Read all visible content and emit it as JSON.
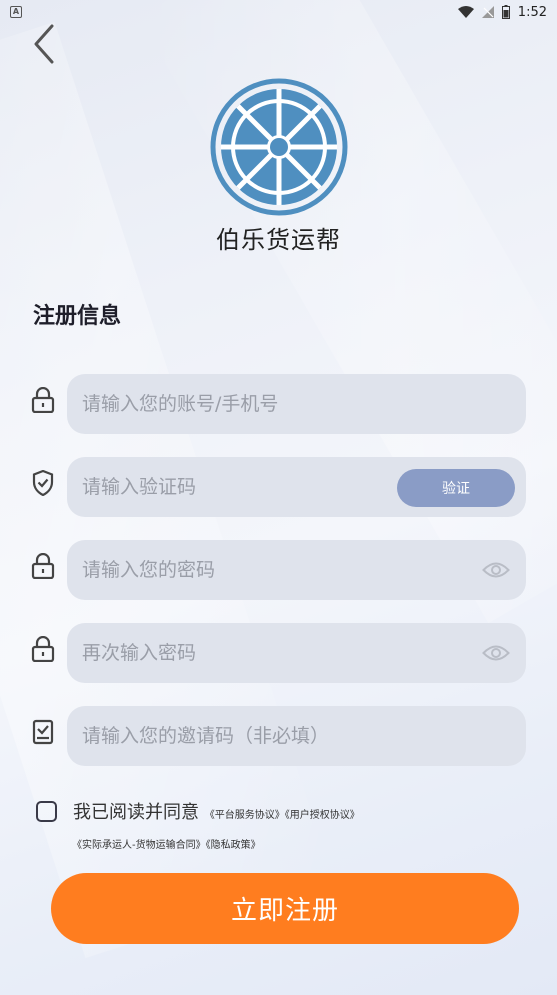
{
  "status_bar": {
    "app_indicator": "A",
    "time": "1:52",
    "icons": [
      "wifi-icon",
      "signal-off-icon",
      "battery-icon"
    ]
  },
  "header": {
    "back_icon": "chevron-left-icon",
    "app_name": "伯乐货运帮",
    "logo_icon": "wheel-logo"
  },
  "form": {
    "section_title": "注册信息",
    "account": {
      "placeholder": "请输入您的账号/手机号",
      "value": "",
      "icon": "lock-icon"
    },
    "code": {
      "placeholder": "请输入验证码",
      "value": "",
      "icon": "shield-check-icon",
      "button_label": "验证"
    },
    "password": {
      "placeholder": "请输入您的密码",
      "value": "",
      "icon": "lock-icon",
      "toggle_icon": "eye-icon"
    },
    "confirm_password": {
      "placeholder": "再次输入密码",
      "value": "",
      "icon": "lock-icon",
      "toggle_icon": "eye-icon"
    },
    "invite_code": {
      "placeholder": "请输入您的邀请码（非必填）",
      "value": "",
      "icon": "badge-check-icon"
    }
  },
  "agreement": {
    "checked": false,
    "prefix": "我已阅读并同意",
    "links": [
      "《平台服务协议》",
      "《用户授权协议》",
      "《实际承运人-货物运输合同》",
      "《隐私政策》"
    ]
  },
  "submit": {
    "label": "立即注册"
  },
  "colors": {
    "accent_orange": "#ff7d1f",
    "verify_button": "#8a9cc6",
    "logo_blue": "#4f8fc0",
    "field_bg": "#dfe3ec"
  }
}
